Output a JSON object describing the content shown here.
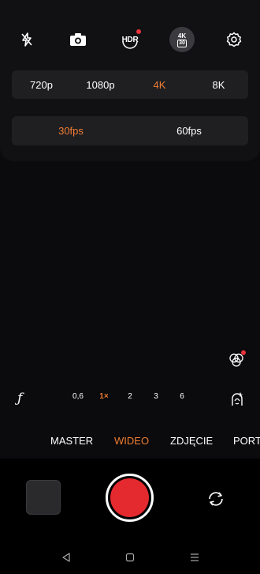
{
  "top_icons": [
    {
      "name": "flash-off-icon"
    },
    {
      "name": "camera-mode-icon"
    },
    {
      "name": "hdr-icon",
      "label": "HDR"
    },
    {
      "name": "resolution-4k30-icon",
      "line1": "4K",
      "line2": "30"
    },
    {
      "name": "settings-gear-icon"
    }
  ],
  "resolution": {
    "options": [
      "720p",
      "1080p",
      "4K",
      "8K"
    ],
    "selected": "4K"
  },
  "framerate": {
    "options": [
      "30fps",
      "60fps"
    ],
    "selected": "30fps"
  },
  "zoom": {
    "aperture_label": "ƒ",
    "levels": [
      "0,6",
      "1×",
      "2",
      "3",
      "6"
    ],
    "selected": "1×"
  },
  "modes": {
    "items": [
      "MASTER",
      "WIDEO",
      "ZDJĘCIE",
      "PORT"
    ],
    "selected": "WIDEO"
  },
  "colors": {
    "accent": "#ef7d32",
    "record": "#e52a2f",
    "indicator_dot": "#e8313a"
  }
}
